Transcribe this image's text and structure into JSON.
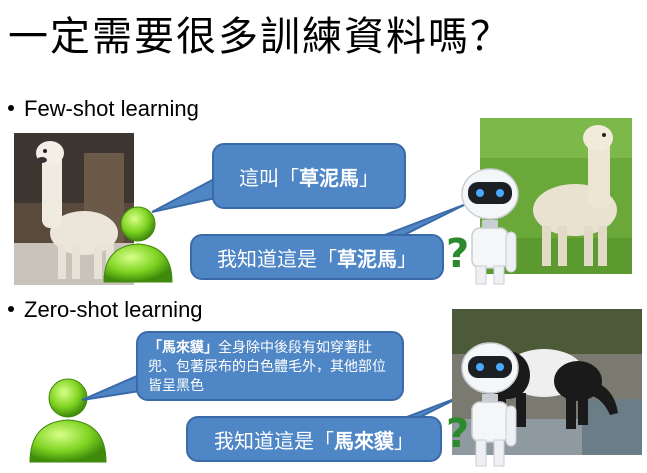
{
  "title": "一定需要很多訓練資料嗎？",
  "bullets": {
    "few_shot": "Few-shot learning",
    "zero_shot": "Zero-shot learning"
  },
  "few_shot": {
    "speech": {
      "prefix": "這叫",
      "open": "「",
      "name": "草泥馬",
      "close": "」"
    },
    "robot_reply": {
      "prefix": "我知道這是",
      "open": "「",
      "name": "草泥馬",
      "close": "」"
    }
  },
  "zero_shot": {
    "description": {
      "open": "「",
      "name": "馬來貘",
      "close": "」",
      "rest": "全身除中後段有如穿著肚兜、包著尿布的白色體毛外，其他部位皆呈黑色"
    },
    "robot_reply": {
      "prefix": "我知道這是",
      "open": "「",
      "name": "馬來貘",
      "close": "」"
    }
  },
  "question_mark": "?",
  "colors": {
    "callout_fill": "#4f86c6",
    "callout_border": "#3b6aa8",
    "person_green": "#7ed321",
    "question_green": "#2c8a2c"
  },
  "icons": [
    "user-icon",
    "robot-icon"
  ]
}
